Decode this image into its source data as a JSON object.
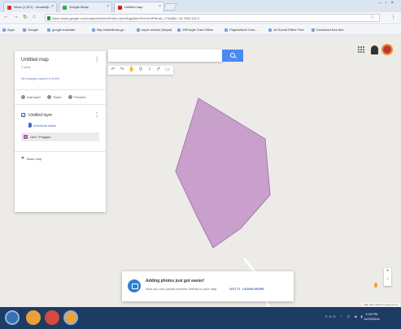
{
  "browser": {
    "tabs": [
      {
        "title": "Inbox (1,871) - donald@...",
        "favicon_color": "#d93025"
      },
      {
        "title": "Google Maps",
        "favicon_color": "#34a853"
      },
      {
        "title": "Untitled map",
        "favicon_color": "#c5221f"
      }
    ],
    "url": "https://www.google.com/maps/d/u/0/edit?mid=1bmSDgqWsmPxKr2mPNmAI--CTk8&ll=-33.7609,151.2",
    "bookmarks": [
      "Apps",
      "Google",
      "google translate",
      "http://mikelkhan.go",
      "super demos (Nepal)",
      "1NPrugle Cars Offers",
      "PagesWorld Com...",
      "16 Sound Effect Free",
      "Download free bee"
    ]
  },
  "panel": {
    "map_title": "Untitled map",
    "views": "1 view",
    "description_link": "All changes saved in Drive",
    "actions": [
      "Add layer",
      "Share",
      "Preview"
    ],
    "layer_title": "Untitled layer",
    "style_link": "Individual styles",
    "feature_label": "Line / Polygon",
    "basemap_label": "Base map"
  },
  "toolbar": {
    "tools": [
      "undo",
      "redo",
      "hand",
      "marker",
      "line",
      "directions",
      "ruler"
    ]
  },
  "toast": {
    "title": "Adding photos just got easier!",
    "body": "Now you can upload pictures directly to your map.",
    "got_it": "GOT IT",
    "learn_more": "LEARN MORE"
  },
  "footer": "Map data ©2016 Google   Terms",
  "taskbar": {
    "apps": [
      {
        "name": "chrome",
        "color": "#e8a23a"
      },
      {
        "name": "chrome",
        "color": "#d64a3b"
      },
      {
        "name": "explorer",
        "color": "#7fb5e8"
      },
      {
        "name": "chrome",
        "color": "#f0a13a"
      }
    ],
    "tray": "ENG ⌃ ⓦ ◀ ▮",
    "time": "4:43 PM",
    "date": "11/29/2016"
  },
  "colors": {
    "polygon_fill": "#c9a0cc",
    "polygon_stroke": "#a878ac",
    "map_bg": "#ecebe8",
    "accent": "#4a8af4"
  }
}
